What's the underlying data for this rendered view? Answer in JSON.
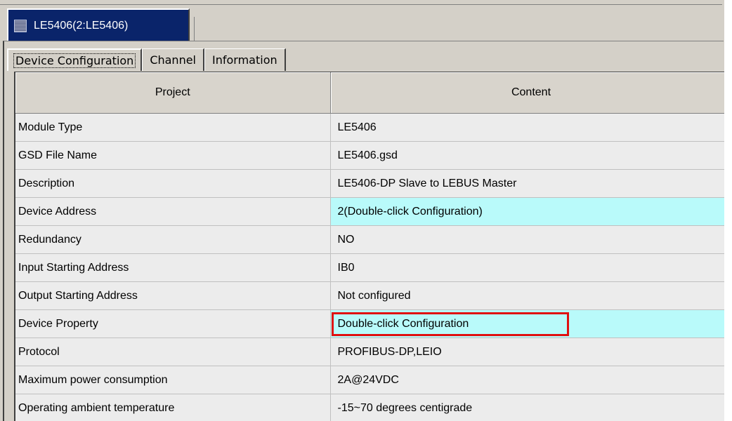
{
  "doc_tab": {
    "icon": "module-icon",
    "label": "LE5406(2:LE5406)"
  },
  "tabs": [
    {
      "label": "Device Configuration",
      "active": true
    },
    {
      "label": "Channel",
      "active": false
    },
    {
      "label": "Information",
      "active": false
    }
  ],
  "table": {
    "headers": {
      "project": "Project",
      "content": "Content"
    },
    "rows": [
      {
        "project": "Module Type",
        "content": "LE5406"
      },
      {
        "project": "GSD File Name",
        "content": "LE5406.gsd"
      },
      {
        "project": "Description",
        "content": "LE5406-DP Slave to LEBUS Master"
      },
      {
        "project": "Device Address",
        "content": "2(Double-click Configuration)",
        "editable": true
      },
      {
        "project": "Redundancy",
        "content": "NO"
      },
      {
        "project": "Input Starting Address",
        "content": "IB0"
      },
      {
        "project": "Output Starting Address",
        "content": "Not configured"
      },
      {
        "project": "Device Property",
        "content": "Double-click Configuration",
        "editable": true,
        "highlighted": true
      },
      {
        "project": "Protocol",
        "content": "PROFIBUS-DP,LEIO"
      },
      {
        "project": "Maximum power consumption",
        "content": "2A@24VDC"
      },
      {
        "project": "Operating ambient temperature",
        "content": "-15~70 degrees centigrade"
      }
    ]
  },
  "colors": {
    "editable_cell": "#b9fafa",
    "highlight_border": "#e01010",
    "doc_tab_bg": "#0a246a"
  }
}
